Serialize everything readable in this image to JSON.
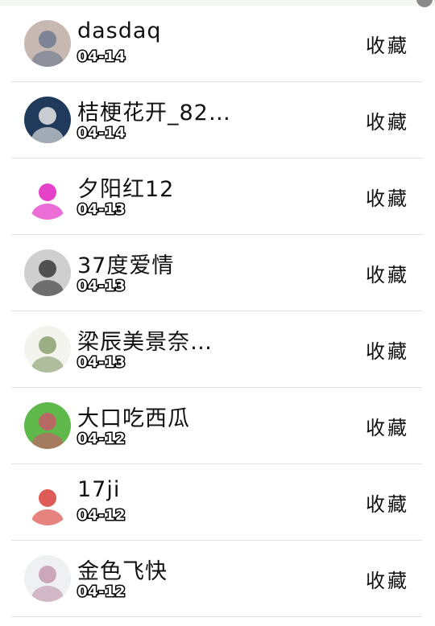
{
  "items": [
    {
      "name": "dasdaq",
      "date": "04-14",
      "action": "收藏",
      "avatar_colors": [
        "#c7b9b2",
        "#6f7a8f"
      ]
    },
    {
      "name": "桔梗花开_82…",
      "date": "04-14",
      "action": "收藏",
      "avatar_colors": [
        "#1f3a5a",
        "#e8e8e8"
      ]
    },
    {
      "name": "夕阳红12",
      "date": "04-13",
      "action": "收藏",
      "avatar_colors": [
        "#ffffff",
        "#e020c0"
      ]
    },
    {
      "name": "37度爱情",
      "date": "04-13",
      "action": "收藏",
      "avatar_colors": [
        "#cfcfcf",
        "#3a3a3a"
      ]
    },
    {
      "name": "梁辰美景奈…",
      "date": "04-13",
      "action": "收藏",
      "avatar_colors": [
        "#f4f4ee",
        "#8aa070"
      ]
    },
    {
      "name": "大口吃西瓜",
      "date": "04-12",
      "action": "收藏",
      "avatar_colors": [
        "#5fb84a",
        "#c95b6a"
      ]
    },
    {
      "name": "17ji",
      "date": "04-12",
      "action": "收藏",
      "avatar_colors": [
        "#ffffff",
        "#d8403a"
      ]
    },
    {
      "name": "金色飞快",
      "date": "04-12",
      "action": "收藏",
      "avatar_colors": [
        "#eef0f2",
        "#c59ab0"
      ]
    }
  ]
}
